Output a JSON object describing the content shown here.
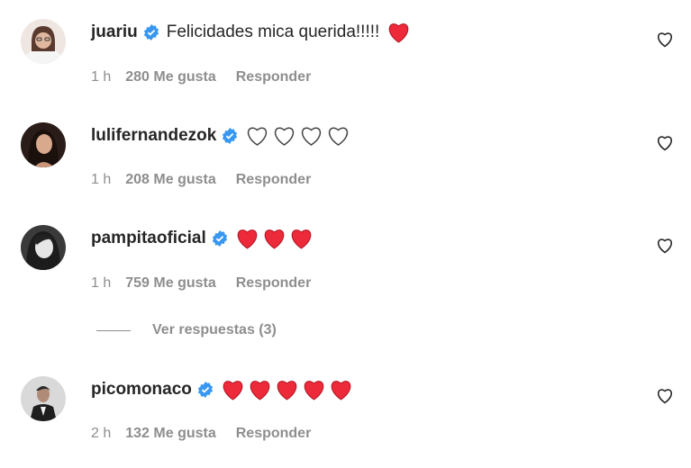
{
  "comments": [
    {
      "username": "juariu",
      "text": "Felicidades mica querida!!!!!",
      "hearts": [
        "red"
      ],
      "time": "1 h",
      "likes": "280 Me gusta",
      "reply": "Responder",
      "avatar": "woman-glasses-avatar"
    },
    {
      "username": "lulifernandezok",
      "text": "",
      "hearts": [
        "white",
        "white",
        "white",
        "white"
      ],
      "time": "1 h",
      "likes": "208 Me gusta",
      "reply": "Responder",
      "avatar": "woman-dark-hair-avatar"
    },
    {
      "username": "pampitaoficial",
      "text": "",
      "hearts": [
        "red",
        "red",
        "red"
      ],
      "time": "1 h",
      "likes": "759 Me gusta",
      "reply": "Responder",
      "avatar": "woman-bw-avatar"
    },
    {
      "username": "picomonaco",
      "text": "",
      "hearts": [
        "red",
        "red",
        "red",
        "red",
        "red"
      ],
      "time": "2 h",
      "likes": "132 Me gusta",
      "reply": "Responder",
      "avatar": "man-suit-avatar"
    }
  ],
  "view_replies": "Ver respuestas (3)",
  "colors": {
    "verified": "#3897f0",
    "heart_red": "#ed2a3a",
    "meta_gray": "#8e8e8e",
    "text": "#262626"
  }
}
